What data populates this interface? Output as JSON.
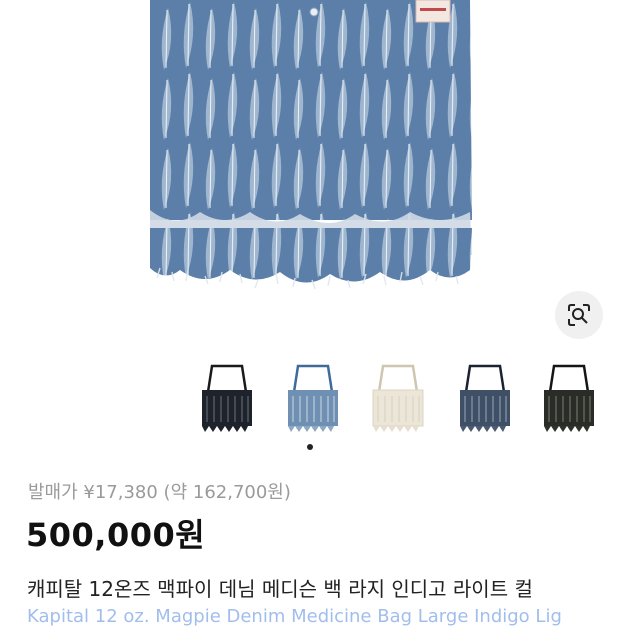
{
  "product": {
    "price_label": "발매가 ¥17,380 (약 162,700원)",
    "price": "500,000원",
    "title_ko": "캐피탈 12온즈 맥파이 데님 메디슨 백 라지 인디고 라이트 컬",
    "title_en": "Kapital 12 oz. Magpie Denim Medicine Bag Large Indigo Lig"
  },
  "thumbnails": [
    {
      "color": "#1e232b",
      "icon": "black-bag"
    },
    {
      "color": "#6f8fb3",
      "icon": "light-indigo-bag"
    },
    {
      "color": "#ece6d8",
      "icon": "ecru-bag"
    },
    {
      "color": "#3f4f66",
      "icon": "indigo-bag"
    },
    {
      "color": "#2a2c27",
      "icon": "black-olive-bag"
    }
  ],
  "carousel": {
    "active_index": 0,
    "count": 1
  },
  "colors": {
    "accent_link": "#2f6fd6",
    "price_text": "#111111",
    "muted_text": "#9a9a9a"
  }
}
